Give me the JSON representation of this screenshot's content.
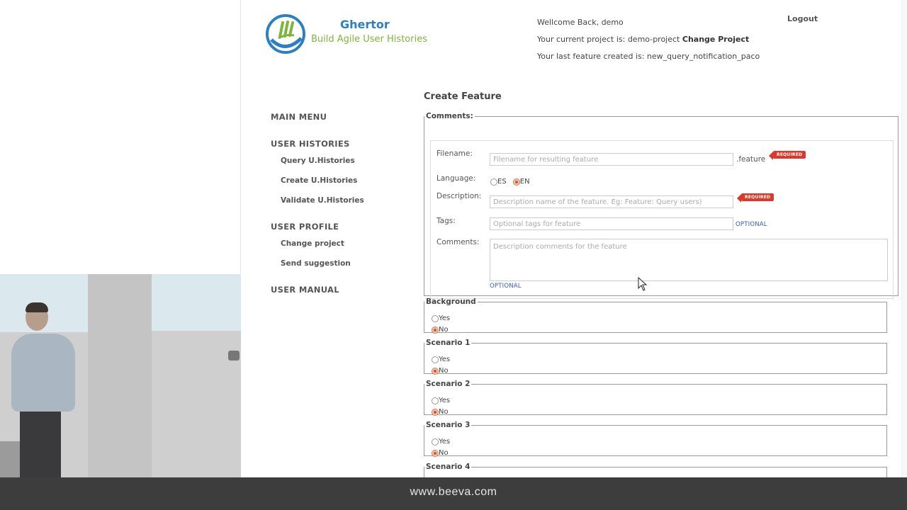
{
  "app": {
    "logo_title": "Ghertor",
    "logo_subtitle": "Build Agile User Histories",
    "colors": {
      "brand_blue": "#2e7fc1",
      "brand_green": "#7db63a",
      "required_red": "#d93a2b",
      "optional_blue": "#3a55c8"
    }
  },
  "header": {
    "welcome": "Wellcome Back, demo",
    "project_prefix": "Your current project is: demo-project",
    "change_project": "Change Project",
    "last_feature": "Your last feature created is: new_query_notification_paco",
    "logout": "Logout"
  },
  "sidebar": {
    "main_menu": "MAIN MENU",
    "user_histories": "USER HISTORIES",
    "query": "Query U.Histories",
    "create": "Create U.Histories",
    "validate": "Validate U.Histories",
    "user_profile": "USER PROFILE",
    "change_project": "Change project",
    "send_suggestion": "Send suggestion",
    "user_manual": "USER MANUAL"
  },
  "form": {
    "title": "Create Feature",
    "comments_legend": "Comments:",
    "filename_label": "Filename:",
    "filename_placeholder": "Filename for resulting feature",
    "filename_suffix": ".feature",
    "required_badge": "REQUIRED",
    "language_label": "Language:",
    "lang_es": "ES",
    "lang_en": "EN",
    "language_selected": "EN",
    "description_label": "Description:",
    "description_placeholder": "Description name of the feature. Eg: Feature: Query users)",
    "tags_label": "Tags:",
    "tags_placeholder": "Optional tags for feature",
    "optional_badge": "OPTIONAL",
    "comments_label": "Comments:",
    "comments_placeholder": "Description comments for the feature",
    "yes_label": "Yes",
    "no_label": "No",
    "sections": [
      {
        "legend": "Background",
        "selected": "No"
      },
      {
        "legend": "Scenario 1",
        "selected": "No"
      },
      {
        "legend": "Scenario 2",
        "selected": "No"
      },
      {
        "legend": "Scenario 3",
        "selected": "No"
      },
      {
        "legend": "Scenario 4",
        "selected": ""
      }
    ]
  },
  "footer": {
    "url": "www.beeva.com"
  }
}
